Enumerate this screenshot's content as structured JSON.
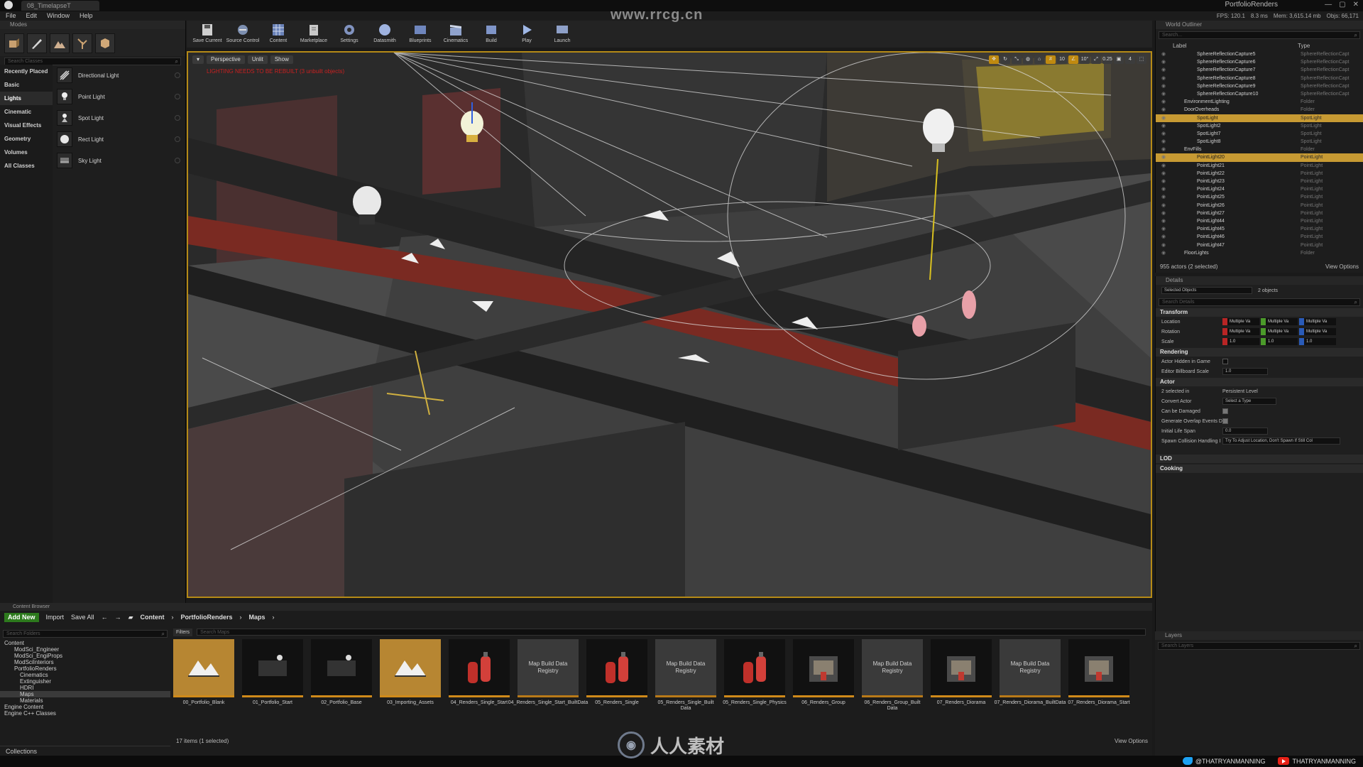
{
  "title_bar": {
    "tab": "08_TimelapseT",
    "project": "PortfolioRenders",
    "controls": [
      "—",
      "▢",
      "✕"
    ]
  },
  "menu": {
    "items": [
      "File",
      "Edit",
      "Window",
      "Help"
    ],
    "stats": [
      "FPS: 120.1",
      "8.3 ms",
      "Mem: 3,615.14 mb",
      "Objs: 66,171"
    ]
  },
  "modes": {
    "tab": "Modes",
    "search_placeholder": "Search Classes",
    "categories": [
      "Recently Placed",
      "Basic",
      "Lights",
      "Cinematic",
      "Visual Effects",
      "Geometry",
      "Volumes",
      "All Classes"
    ],
    "selected_category": "Lights",
    "placeables": [
      "Directional Light",
      "Point Light",
      "Spot Light",
      "Rect Light",
      "Sky Light"
    ]
  },
  "toolbar": {
    "buttons": [
      "Save Current",
      "Source Control",
      "Content",
      "Marketplace",
      "Settings",
      "Datasmith",
      "Blueprints",
      "Cinematics",
      "Build",
      "Play",
      "Launch"
    ]
  },
  "watermark": "www.rrcg.cn",
  "viewport": {
    "perspective": "Perspective",
    "lit": "Unlit",
    "show": "Show",
    "warning": "LIGHTING NEEDS TO BE REBUILT (3 unbuilt objects)",
    "right_buttons": [
      "10",
      "0.25",
      "4"
    ]
  },
  "outliner": {
    "tab": "World Outliner",
    "search_placeholder": "Search...",
    "col_label": "Label",
    "col_type": "Type",
    "rows": [
      {
        "label": "SphereReflectionCapture5",
        "type": "SphereReflectionCapt",
        "selected": false
      },
      {
        "label": "SphereReflectionCapture6",
        "type": "SphereReflectionCapt",
        "selected": false
      },
      {
        "label": "SphereReflectionCapture7",
        "type": "SphereReflectionCapt",
        "selected": false
      },
      {
        "label": "SphereReflectionCapture8",
        "type": "SphereReflectionCapt",
        "selected": false
      },
      {
        "label": "SphereReflectionCapture9",
        "type": "SphereReflectionCapt",
        "selected": false
      },
      {
        "label": "SphereReflectionCapture10",
        "type": "SphereReflectionCapt",
        "selected": false
      },
      {
        "label": "EnvironmentLighting",
        "type": "Folder",
        "selected": false
      },
      {
        "label": "DoorOverheads",
        "type": "Folder",
        "selected": false
      },
      {
        "label": "SpotLight",
        "type": "SpotLight",
        "selected": true
      },
      {
        "label": "SpotLight2",
        "type": "SpotLight",
        "selected": false
      },
      {
        "label": "SpotLight7",
        "type": "SpotLight",
        "selected": false
      },
      {
        "label": "SpotLight8",
        "type": "SpotLight",
        "selected": false
      },
      {
        "label": "EnvFills",
        "type": "Folder",
        "selected": false
      },
      {
        "label": "PointLight20",
        "type": "PointLight",
        "selected": true
      },
      {
        "label": "PointLight21",
        "type": "PointLight",
        "selected": false
      },
      {
        "label": "PointLight22",
        "type": "PointLight",
        "selected": false
      },
      {
        "label": "PointLight23",
        "type": "PointLight",
        "selected": false
      },
      {
        "label": "PointLight24",
        "type": "PointLight",
        "selected": false
      },
      {
        "label": "PointLight25",
        "type": "PointLight",
        "selected": false
      },
      {
        "label": "PointLight26",
        "type": "PointLight",
        "selected": false
      },
      {
        "label": "PointLight27",
        "type": "PointLight",
        "selected": false
      },
      {
        "label": "PointLight44",
        "type": "PointLight",
        "selected": false
      },
      {
        "label": "PointLight45",
        "type": "PointLight",
        "selected": false
      },
      {
        "label": "PointLight46",
        "type": "PointLight",
        "selected": false
      },
      {
        "label": "PointLight47",
        "type": "PointLight",
        "selected": false
      },
      {
        "label": "FloorLights",
        "type": "Folder",
        "selected": false
      }
    ],
    "footer": "955 actors (2 selected)",
    "view_options": "View Options"
  },
  "details": {
    "tab": "Details",
    "selected": "2 objects",
    "selected_field": "Selected Objects",
    "search_placeholder": "Search Details",
    "transform_title": "Transform",
    "location_label": "Location",
    "rotation_label": "Rotation",
    "scale_label": "Scale",
    "multi": "Multiple Va",
    "scale_val": "1.0",
    "rendering_title": "Rendering",
    "hidden_label": "Actor Hidden in Game",
    "billboard_label": "Editor Billboard Scale",
    "billboard_val": "1.0",
    "actor_title": "Actor",
    "selected_in": "2 selected in",
    "level": "Persistent Level",
    "convert_label": "Convert Actor",
    "convert_val": "Select a Type",
    "damaged_label": "Can be Damaged",
    "overlap_label": "Generate Overlap Events D",
    "lifespan_label": "Initial Life Span",
    "lifespan_val": "0.0",
    "spawn_label": "Spawn Collision Handling I",
    "spawn_val": "Try To Adjust Location, Don't Spawn If Still Col",
    "lod_title": "LOD",
    "cooking_title": "Cooking"
  },
  "content_browser": {
    "tab": "Content Browser",
    "add_new": "Add New",
    "import": "Import",
    "save_all": "Save All",
    "breadcrumb": [
      "Content",
      "PortfolioRenders",
      "Maps"
    ],
    "folder_search": "Search Folders",
    "filters": "Filters",
    "asset_search": "Search Maps",
    "tree": [
      {
        "label": "Content",
        "depth": 0,
        "selected": false
      },
      {
        "label": "ModSci_Engineer",
        "depth": 1,
        "selected": false
      },
      {
        "label": "ModSci_EngiProps",
        "depth": 1,
        "selected": false
      },
      {
        "label": "ModSciInteriors",
        "depth": 1,
        "selected": false
      },
      {
        "label": "PortfolioRenders",
        "depth": 1,
        "selected": false
      },
      {
        "label": "Cinematics",
        "depth": 2,
        "selected": false
      },
      {
        "label": "Extinguisher",
        "depth": 2,
        "selected": false
      },
      {
        "label": "HDRI",
        "depth": 2,
        "selected": false
      },
      {
        "label": "Maps",
        "depth": 2,
        "selected": true
      },
      {
        "label": "Materials",
        "depth": 2,
        "selected": false
      },
      {
        "label": "Engine Content",
        "depth": 0,
        "selected": false
      },
      {
        "label": "Engine C++ Classes",
        "depth": 0,
        "selected": false
      }
    ],
    "assets": [
      {
        "name": "00_Portfolio_Blank",
        "kind": "map-orange",
        "thumb": ""
      },
      {
        "name": "01_Portfolio_Start",
        "kind": "map-dark",
        "thumb": ""
      },
      {
        "name": "02_Portfolio_Base",
        "kind": "map-dark",
        "thumb": ""
      },
      {
        "name": "03_Importing_Assets",
        "kind": "map-orange",
        "thumb": ""
      },
      {
        "name": "04_Renders_Single_Start",
        "kind": "extinguisher",
        "thumb": ""
      },
      {
        "name": "04_Renders_Single_Start_BuiltData",
        "kind": "registry",
        "thumb": "Map Build Data Registry"
      },
      {
        "name": "05_Renders_Single",
        "kind": "extinguisher",
        "thumb": ""
      },
      {
        "name": "05_Renders_Single_Built Data",
        "kind": "registry",
        "thumb": "Map Build Data Registry"
      },
      {
        "name": "05_Renders_Single_Physics",
        "kind": "extinguisher",
        "thumb": ""
      },
      {
        "name": "06_Renders_Group",
        "kind": "group",
        "thumb": ""
      },
      {
        "name": "06_Renders_Group_Built Data",
        "kind": "registry",
        "thumb": "Map Build Data Registry"
      },
      {
        "name": "07_Renders_Diorama",
        "kind": "group",
        "thumb": ""
      },
      {
        "name": "07_Renders_Diorama_BuiltData",
        "kind": "registry",
        "thumb": "Map Build Data Registry"
      },
      {
        "name": "07_Renders_Diorama_Start",
        "kind": "group",
        "thumb": ""
      }
    ],
    "count": "17 items (1 selected)",
    "view_options": "View Options",
    "collections": "Collections"
  },
  "layers": {
    "tab": "Layers",
    "search_placeholder": "Search Layers"
  },
  "bottom": {
    "logo_text": "人人素材",
    "twitter": "@THATRYANMANNING",
    "youtube": "THATRYANMANNING"
  },
  "colors": {
    "accent": "#c79a33",
    "viewport_border": "#b58a16",
    "add_new": "#2d7a1d"
  }
}
